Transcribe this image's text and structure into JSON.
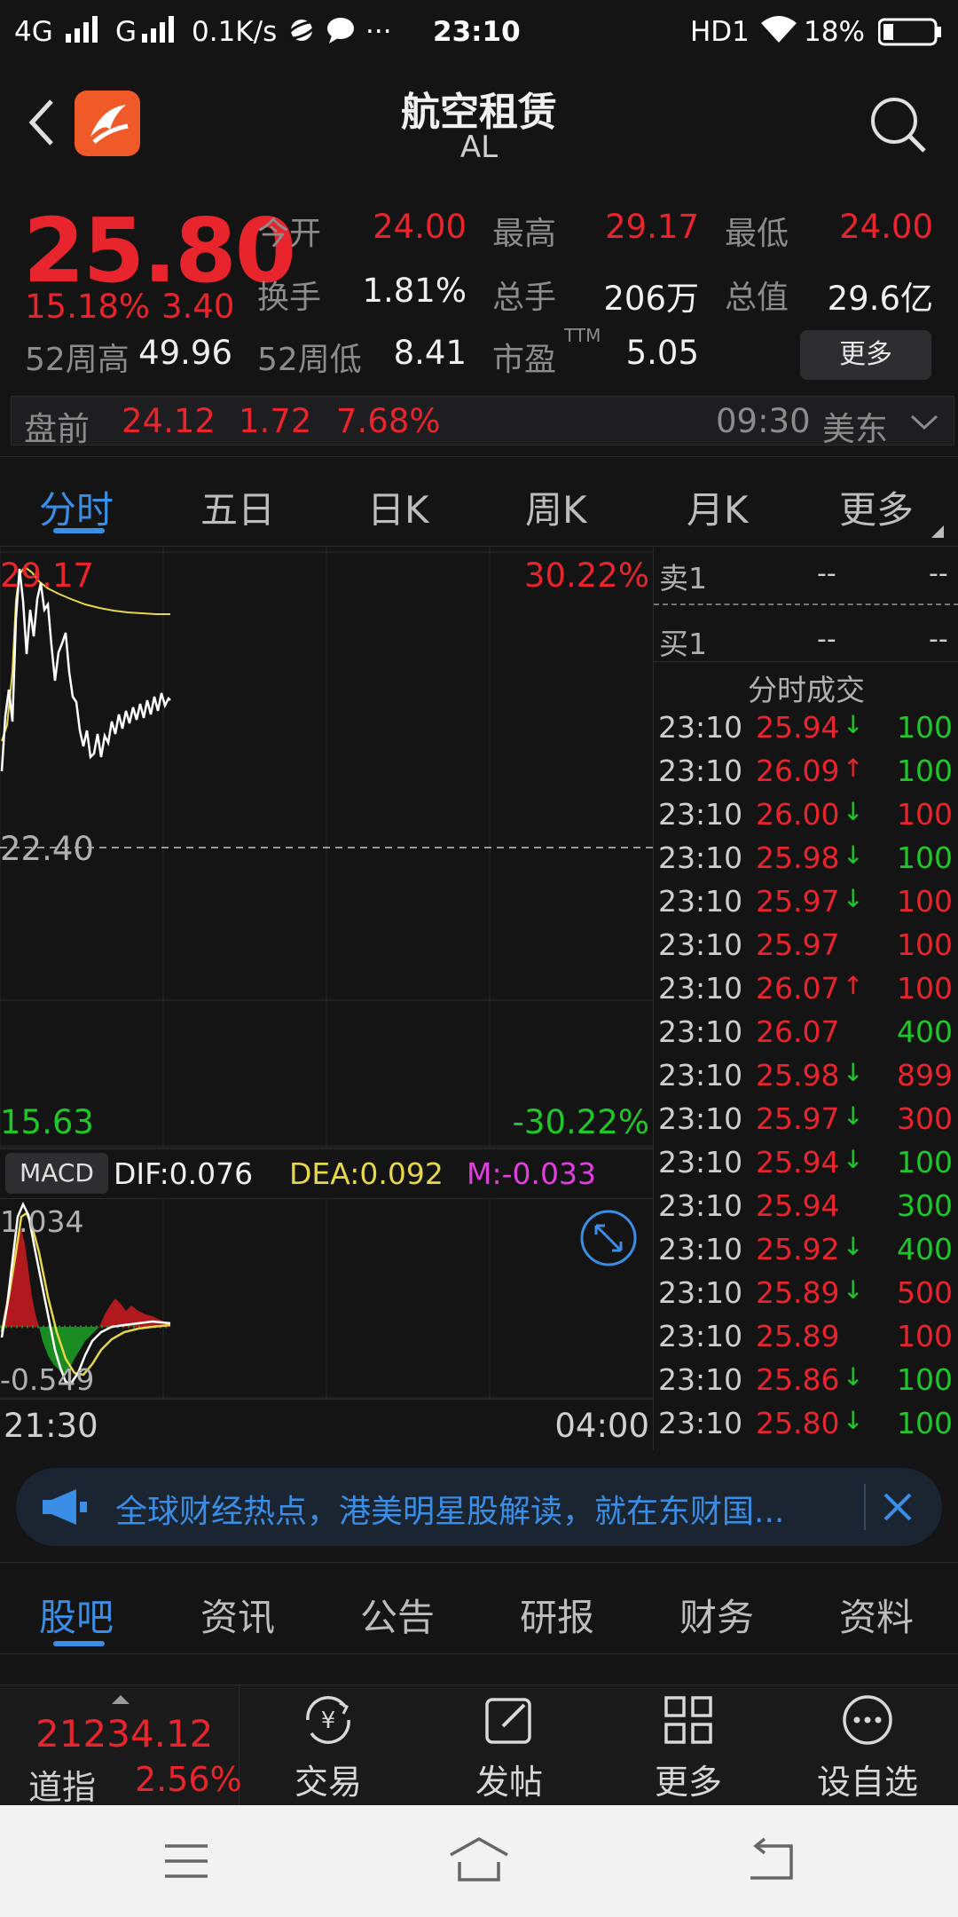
{
  "status_bar": {
    "left": "4G",
    "carrier2": "G",
    "speed": "0.1K/s",
    "more": "···",
    "time": "23:10",
    "hd": "HD1",
    "battery": "18%"
  },
  "header": {
    "title": "航空租赁",
    "ticker": "AL"
  },
  "quote": {
    "price": "25.80",
    "change_pct": "15.18%",
    "change": "3.40",
    "open_label": "今开",
    "open": "24.00",
    "high_label": "最高",
    "high": "29.17",
    "low_label": "最低",
    "low": "24.00",
    "turnover_label": "换手",
    "turnover": "1.81%",
    "volume_label": "总手",
    "volume": "206万",
    "mcap_label": "总值",
    "mcap": "29.6亿",
    "w52h_label": "52周高",
    "w52h": "49.96",
    "w52l_label": "52周低",
    "w52l": "8.41",
    "pe_label": "市盈",
    "pe_sup": "TTM",
    "pe": "5.05",
    "more_button": "更多"
  },
  "premarket": {
    "label": "盘前",
    "price": "24.12",
    "change": "1.72",
    "change_pct": "7.68%",
    "time": "09:30",
    "zone": "美东"
  },
  "chart_tabs": [
    "分时",
    "五日",
    "日K",
    "周K",
    "月K",
    "更多"
  ],
  "intraday": {
    "y_top": "29.17",
    "y_mid": "22.40",
    "y_bottom": "15.63",
    "pct_top": "30.22%",
    "pct_bottom": "-30.22%",
    "x_start": "21:30",
    "x_end": "04:00"
  },
  "macd": {
    "label": "MACD",
    "dif": "DIF:0.076",
    "dea": "DEA:0.092",
    "m": "M:-0.033",
    "y_top": "1.034",
    "y_bottom": "-0.549"
  },
  "order_book": {
    "sell1_label": "卖1",
    "sell1_price": "--",
    "sell1_vol": "--",
    "buy1_label": "买1",
    "buy1_price": "--",
    "buy1_vol": "--"
  },
  "trades_title": "分时成交",
  "trades": [
    {
      "time": "23:10",
      "price": "25.94",
      "arrow": "↓",
      "vol": "100",
      "vcolor": "green"
    },
    {
      "time": "23:10",
      "price": "26.09",
      "arrow": "↑",
      "vol": "100",
      "vcolor": "green"
    },
    {
      "time": "23:10",
      "price": "26.00",
      "arrow": "↓",
      "vol": "100",
      "vcolor": "red"
    },
    {
      "time": "23:10",
      "price": "25.98",
      "arrow": "↓",
      "vol": "100",
      "vcolor": "green"
    },
    {
      "time": "23:10",
      "price": "25.97",
      "arrow": "↓",
      "vol": "100",
      "vcolor": "red"
    },
    {
      "time": "23:10",
      "price": "25.97",
      "arrow": "",
      "vol": "100",
      "vcolor": "red"
    },
    {
      "time": "23:10",
      "price": "26.07",
      "arrow": "↑",
      "vol": "100",
      "vcolor": "red"
    },
    {
      "time": "23:10",
      "price": "26.07",
      "arrow": "",
      "vol": "400",
      "vcolor": "green"
    },
    {
      "time": "23:10",
      "price": "25.98",
      "arrow": "↓",
      "vol": "899",
      "vcolor": "red"
    },
    {
      "time": "23:10",
      "price": "25.97",
      "arrow": "↓",
      "vol": "300",
      "vcolor": "red"
    },
    {
      "time": "23:10",
      "price": "25.94",
      "arrow": "↓",
      "vol": "100",
      "vcolor": "green"
    },
    {
      "time": "23:10",
      "price": "25.94",
      "arrow": "",
      "vol": "300",
      "vcolor": "green"
    },
    {
      "time": "23:10",
      "price": "25.92",
      "arrow": "↓",
      "vol": "400",
      "vcolor": "green"
    },
    {
      "time": "23:10",
      "price": "25.89",
      "arrow": "↓",
      "vol": "500",
      "vcolor": "red"
    },
    {
      "time": "23:10",
      "price": "25.89",
      "arrow": "",
      "vol": "100",
      "vcolor": "red"
    },
    {
      "time": "23:10",
      "price": "25.86",
      "arrow": "↓",
      "vol": "100",
      "vcolor": "green"
    },
    {
      "time": "23:10",
      "price": "25.80",
      "arrow": "↓",
      "vol": "100",
      "vcolor": "green"
    }
  ],
  "banner": {
    "text": "全球财经热点，港美明星股解读，就在东财国..."
  },
  "bottom_tabs": [
    "股吧",
    "资讯",
    "公告",
    "研报",
    "财务",
    "资料"
  ],
  "index_ticker": {
    "value": "21234.12",
    "name": "道指",
    "change_pct": "2.56%"
  },
  "bottom_nav": {
    "trade": "交易",
    "post": "发帖",
    "more": "更多",
    "watchlist": "设自选"
  },
  "colors": {
    "up": "#e8252c",
    "down": "#1fc72a",
    "accent": "#3a8ee6",
    "price_line": "#ffffff",
    "avg_line": "#e6d84a"
  }
}
